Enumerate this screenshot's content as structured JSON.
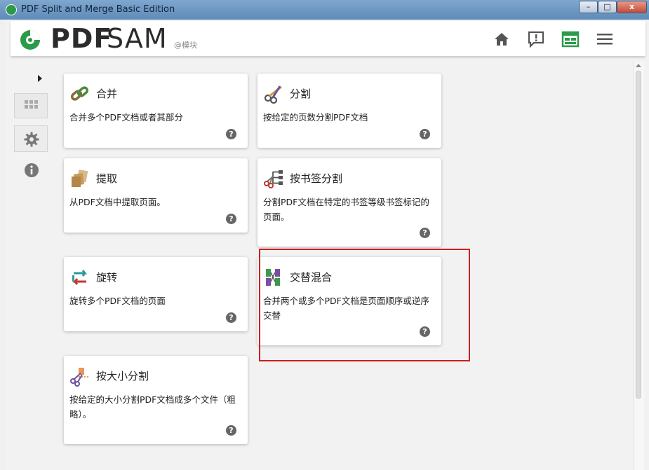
{
  "window": {
    "title": "PDF Split and Merge Basic Edition",
    "minimize_label": "–",
    "maximize_label": "□",
    "close_label": "x"
  },
  "header": {
    "logo_pdf": "PDF",
    "logo_sam": "SAM",
    "logo_sub": "@模块",
    "icons": [
      "home-icon",
      "feedback-icon",
      "dashboard-icon",
      "menu-icon"
    ],
    "accent_color": "#2c9a4b"
  },
  "sidebar": {
    "items": [
      "expand-arrow-icon",
      "modules-grid-icon",
      "settings-gear-icon",
      "info-icon"
    ]
  },
  "modules": [
    {
      "title": "合并",
      "desc": "合并多个PDF文档或者其部分",
      "icon": "merge-chain-icon"
    },
    {
      "title": "分割",
      "desc": "按给定的页数分割PDF文档",
      "icon": "split-scissors-icon"
    },
    {
      "title": "提取",
      "desc": "从PDF文档中提取页面。",
      "icon": "extract-pages-icon"
    },
    {
      "title": "按书签分割",
      "desc": "分割PDF文档在特定的书签等级书签标记的页面。",
      "icon": "bookmark-split-icon"
    },
    {
      "title": "旋转",
      "desc": "旋转多个PDF文档的页面",
      "icon": "rotate-icon"
    },
    {
      "title": "交替混合",
      "desc": "合并两个或多个PDF文档是页面顺序或逆序交替",
      "icon": "alternate-mix-icon"
    },
    {
      "title": "按大小分割",
      "desc": "按给定的大小分割PDF文档成多个文件（粗略）。",
      "icon": "size-split-icon"
    }
  ],
  "help_label": "?"
}
